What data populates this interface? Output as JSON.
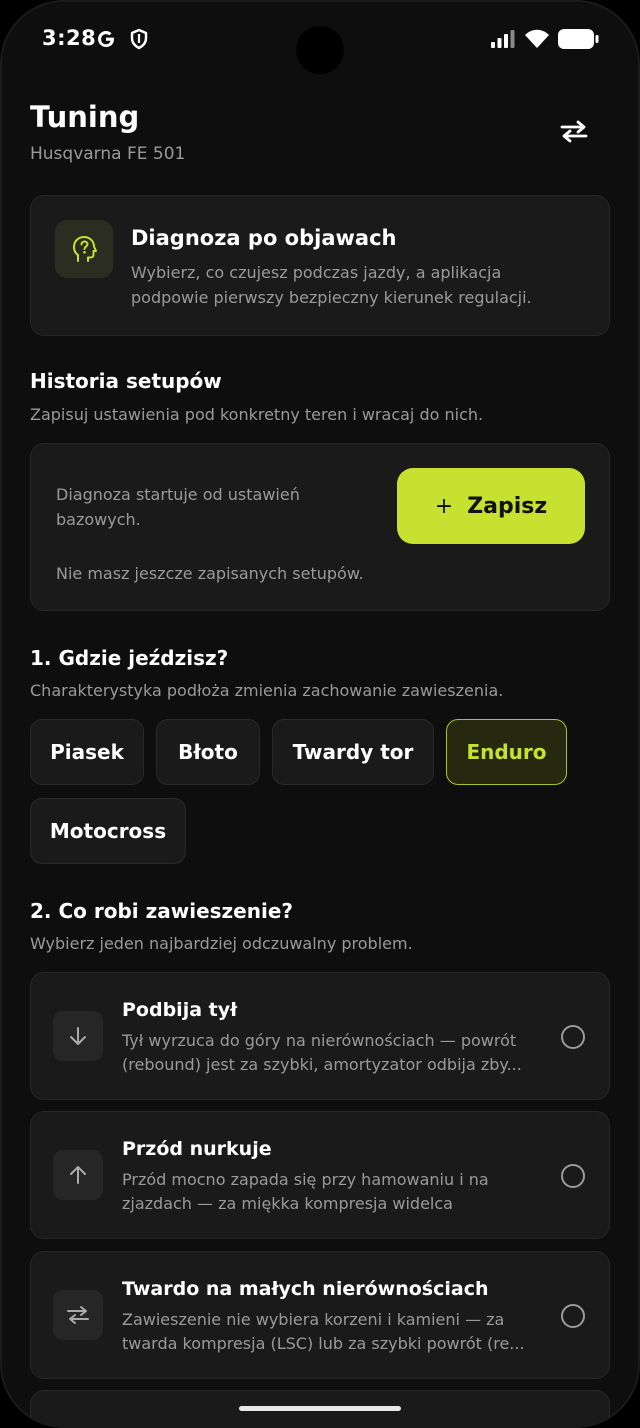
{
  "status_bar": {
    "time": "3:28"
  },
  "header": {
    "title": "Tuning",
    "subtitle": "Husqvarna FE 501"
  },
  "diagnosis_card": {
    "title": "Diagnoza po objawach",
    "text_lines": [
      "Wybierz, co czujesz podczas jazdy, a aplikacja",
      "podpowie pierwszy bezpieczny kierunek regulacji."
    ]
  },
  "history": {
    "title": "Historia setupów",
    "subtitle": "Zapisuj ustawienia pod konkretny teren i wracaj do nich.",
    "base_text_lines": [
      "Diagnoza startuje od ustawień",
      "bazowych."
    ],
    "empty_text": "Nie masz jeszcze zapisanych setupów.",
    "save_plus": "+",
    "save_label": "Zapisz"
  },
  "terrain": {
    "title": "1. Gdzie jeździsz?",
    "subtitle": "Charakterystyka podłoża zmienia zachowanie zawieszenia.",
    "chips": [
      {
        "label": "Piasek",
        "selected": false
      },
      {
        "label": "Błoto",
        "selected": false
      },
      {
        "label": "Twardy tor",
        "selected": false
      },
      {
        "label": "Enduro",
        "selected": true
      },
      {
        "label": "Motocross",
        "selected": false
      }
    ]
  },
  "problems": {
    "title": "2. Co robi zawieszenie?",
    "subtitle": "Wybierz jeden najbardziej odczuwalny problem.",
    "options": [
      {
        "icon": "arrow-down-icon",
        "title": "Podbija tył",
        "line1": "Tył wyrzuca do góry na nierównościach — powrót",
        "line2": "(rebound) jest za szybki, amortyzator odbija zby..."
      },
      {
        "icon": "arrow-up-icon",
        "title": "Przód nurkuje",
        "line1": "Przód mocno zapada się przy hamowaniu i na",
        "line2": "zjazdach — za miękka kompresja widelca"
      },
      {
        "icon": "swap-arrows-icon",
        "title": "Twardo na małych nierównościach",
        "line1": "Zawieszenie nie wybiera korzeni i kamieni — za",
        "line2": "twarda kompresja (LSC) lub za szybki powrót (re..."
      }
    ]
  },
  "colors": {
    "accent": "#c6e12f",
    "background": "#0e0e0e",
    "card": "#1a1a1a",
    "muted_text": "#9a9a9a"
  }
}
